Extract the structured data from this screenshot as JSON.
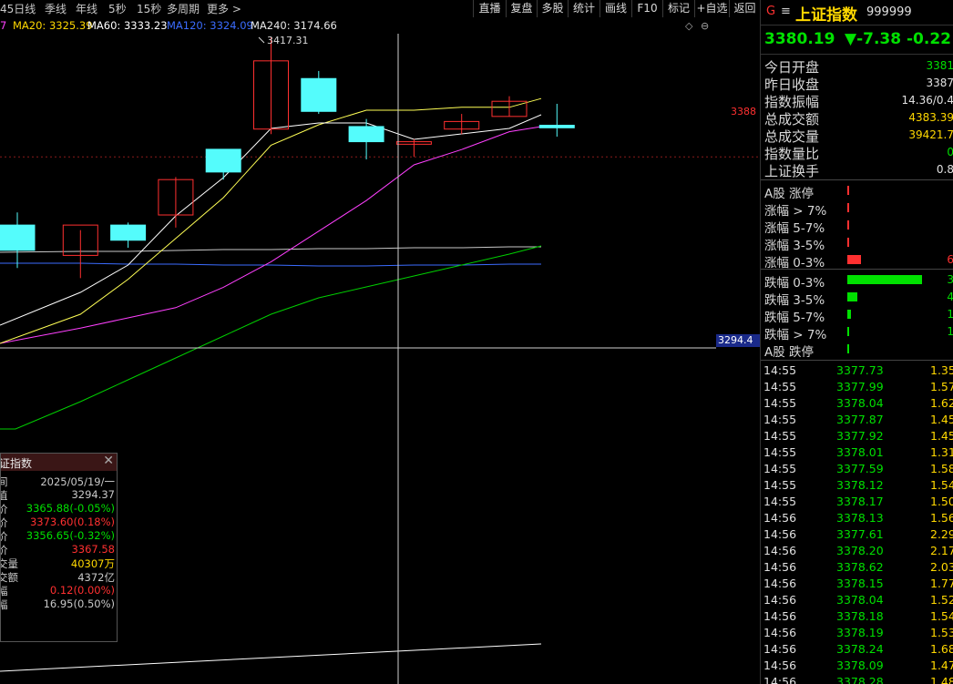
{
  "toolbar": {
    "periods": [
      "45日线",
      "季线",
      "年线",
      "5秒",
      "15秒",
      "多周期",
      "更多 >"
    ],
    "buttons": [
      "直播",
      "复盘",
      "多股",
      "统计",
      "画线",
      "F10",
      "标记",
      "+自选",
      "返回"
    ]
  },
  "ma_legend": [
    {
      "text": "7",
      "color": "#ff40ff"
    },
    {
      "text": "MA20: 3325.39",
      "color": "#ffd800"
    },
    {
      "text": "MA60: 3333.23",
      "color": "#ffffff"
    },
    {
      "text": "MA120: 3324.09",
      "color": "#3b6cff"
    },
    {
      "text": "MA240: 3174.66",
      "color": "#e8e8e8"
    }
  ],
  "chart_data": {
    "type": "candlestick",
    "high_label": "3417.31",
    "price_axis_labels": [
      "3388",
      "3294.4"
    ],
    "colors": {
      "up": "#ff3030",
      "down": "#54fcfc",
      "ma5": "#ffffff",
      "ma10": "#ffff55",
      "ma20": "#ff40ff",
      "ma60": "#00d000",
      "ma120": "#3b6cff",
      "ma240": "#c8c8c8"
    },
    "candles": [
      {
        "o": 3343,
        "h": 3348,
        "l": 3326,
        "c": 3333
      },
      {
        "o": 3331,
        "h": 3341,
        "l": 3322,
        "c": 3343
      },
      {
        "o": 3343,
        "h": 3344,
        "l": 3334,
        "c": 3337
      },
      {
        "o": 3347,
        "h": 3362,
        "l": 3342,
        "c": 3361
      },
      {
        "o": 3373,
        "h": 3373,
        "l": 3361,
        "c": 3364
      },
      {
        "o": 3381,
        "h": 3417.31,
        "l": 3379,
        "c": 3408
      },
      {
        "o": 3401,
        "h": 3404,
        "l": 3387,
        "c": 3388
      },
      {
        "o": 3382,
        "h": 3385,
        "l": 3369,
        "c": 3376
      },
      {
        "o": 3375,
        "h": 3377,
        "l": 3370,
        "c": 3376
      },
      {
        "o": 3381,
        "h": 3387,
        "l": 3379,
        "c": 3384
      },
      {
        "o": 3386,
        "h": 3394,
        "l": 3386,
        "c": 3392
      },
      {
        "o": 3382.5,
        "h": 3391,
        "l": 3378,
        "c": 3381.5
      }
    ],
    "ma": {
      "ma5": [
        3308,
        3320,
        3330,
        3348,
        3362,
        3380,
        3382,
        3382,
        3376,
        3378,
        3380,
        3385
      ],
      "ma10": [
        3300,
        3310,
        3322,
        3336,
        3350,
        3368,
        3375,
        3380,
        3380,
        3381,
        3381,
        3384
      ],
      "ma20": [
        3294,
        3300,
        3304,
        3308,
        3316,
        3326,
        3338,
        3350,
        3364,
        3370,
        3377,
        3379
      ],
      "ma60": [
        3258,
        3268,
        3276,
        3284,
        3292,
        3300,
        3306,
        3310,
        3314,
        3318,
        3322,
        3325
      ],
      "ma120": [
        3305,
        3305,
        3304,
        3304,
        3303,
        3303,
        3302,
        3302,
        3303,
        3303,
        3304,
        3304
      ],
      "ma240": [
        3306,
        3307,
        3307,
        3308,
        3309,
        3309,
        3310,
        3310,
        3311,
        3311,
        3312,
        3312
      ]
    }
  },
  "info_box": {
    "title": "证指数",
    "rows": [
      {
        "label": "时间",
        "value": "2025/05/19/一",
        "color": "#c8c8c8"
      },
      {
        "label": "数值",
        "value": "3294.37",
        "color": "#c8c8c8"
      },
      {
        "label": "开价",
        "value": "3365.88(-0.05%)",
        "color": "#00e000"
      },
      {
        "label": "高价",
        "value": "3373.60(0.18%)",
        "color": "#ff3030"
      },
      {
        "label": "低价",
        "value": "3356.65(-0.32%)",
        "color": "#00e000"
      },
      {
        "label": "收价",
        "value": "3367.58",
        "color": "#ff3030"
      },
      {
        "label": "成交量",
        "value": "40307万",
        "color": "#ffd800"
      },
      {
        "label": "成交额",
        "value": "4372亿",
        "color": "#c8c8c8"
      },
      {
        "label": "涨幅",
        "value": "0.12(0.00%)",
        "color": "#ff3030"
      },
      {
        "label": "振幅",
        "value": "16.95(0.50%)",
        "color": "#c8c8c8"
      }
    ]
  },
  "index": {
    "g_label": "G",
    "menu_icon": "≡",
    "name": "上证指数",
    "code": "999999",
    "price": "3380.19",
    "change": "▼-7.38",
    "pct": "-0.22"
  },
  "stats": [
    {
      "label": "今日开盘",
      "value": "3381",
      "color": "#00e000"
    },
    {
      "label": "昨日收盘",
      "value": "3387",
      "color": "#e0e0e0"
    },
    {
      "label": "指数振幅",
      "value": "14.36/0.4",
      "color": "#e0e0e0"
    },
    {
      "label": "总成交额",
      "value": "4383.39",
      "color": "#ffd800"
    },
    {
      "label": "总成交量",
      "value": "39421.7",
      "color": "#ffd800"
    },
    {
      "label": "指数量比",
      "value": "0",
      "color": "#00e000"
    },
    {
      "label": "上证换手",
      "value": "0.8",
      "color": "#e0e0e0"
    }
  ],
  "up_dist": [
    {
      "label": "A股 涨停",
      "bar": 0.0,
      "num": "",
      "color": "#ff3030"
    },
    {
      "label": "涨幅 > 7%",
      "bar": 0.0,
      "num": "",
      "color": "#ff3030"
    },
    {
      "label": "涨幅 5-7%",
      "bar": 0.0,
      "num": "",
      "color": "#ff3030"
    },
    {
      "label": "涨幅 3-5%",
      "bar": 0.0,
      "num": "",
      "color": "#ff3030"
    },
    {
      "label": "涨幅 0-3%",
      "bar": 0.18,
      "num": "6",
      "color": "#ff3030"
    }
  ],
  "down_dist": [
    {
      "label": "跌幅 0-3%",
      "bar": 1.0,
      "num": "3",
      "color": "#00e000"
    },
    {
      "label": "跌幅 3-5%",
      "bar": 0.14,
      "num": "4",
      "color": "#00e000"
    },
    {
      "label": "跌幅 5-7%",
      "bar": 0.05,
      "num": "1",
      "color": "#00e000"
    },
    {
      "label": "跌幅 > 7%",
      "bar": 0.03,
      "num": "1",
      "color": "#00e000"
    },
    {
      "label": "A股 跌停",
      "bar": 0.0,
      "num": "",
      "color": "#00e000"
    }
  ],
  "ticks": [
    {
      "time": "14:55",
      "price": "3377.73",
      "vol": "1.35"
    },
    {
      "time": "14:55",
      "price": "3377.99",
      "vol": "1.57"
    },
    {
      "time": "14:55",
      "price": "3378.04",
      "vol": "1.62"
    },
    {
      "time": "14:55",
      "price": "3377.87",
      "vol": "1.45"
    },
    {
      "time": "14:55",
      "price": "3377.92",
      "vol": "1.45"
    },
    {
      "time": "14:55",
      "price": "3378.01",
      "vol": "1.31"
    },
    {
      "time": "14:55",
      "price": "3377.59",
      "vol": "1.58"
    },
    {
      "time": "14:55",
      "price": "3378.12",
      "vol": "1.54"
    },
    {
      "time": "14:55",
      "price": "3378.17",
      "vol": "1.50"
    },
    {
      "time": "14:56",
      "price": "3378.13",
      "vol": "1.56"
    },
    {
      "time": "14:56",
      "price": "3377.61",
      "vol": "2.29"
    },
    {
      "time": "14:56",
      "price": "3378.20",
      "vol": "2.17"
    },
    {
      "time": "14:56",
      "price": "3378.62",
      "vol": "2.03"
    },
    {
      "time": "14:56",
      "price": "3378.15",
      "vol": "1.77"
    },
    {
      "time": "14:56",
      "price": "3378.04",
      "vol": "1.52"
    },
    {
      "time": "14:56",
      "price": "3378.18",
      "vol": "1.54"
    },
    {
      "time": "14:56",
      "price": "3378.19",
      "vol": "1.53"
    },
    {
      "time": "14:56",
      "price": "3378.24",
      "vol": "1.68"
    },
    {
      "time": "14:56",
      "price": "3378.09",
      "vol": "1.47"
    },
    {
      "time": "14:56",
      "price": "3378.28",
      "vol": "1.48"
    }
  ]
}
